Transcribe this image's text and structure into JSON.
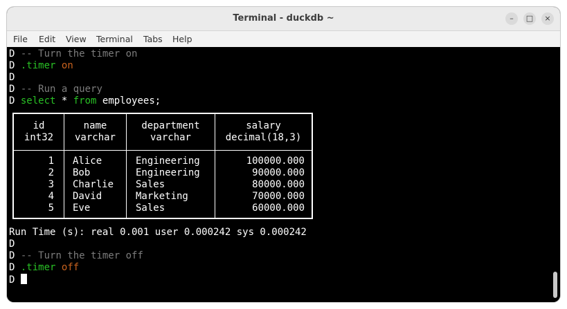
{
  "window": {
    "title": "Terminal - duckdb ~",
    "controls": {
      "minimize": "–",
      "maximize": "□",
      "close": "×"
    }
  },
  "menu": [
    "File",
    "Edit",
    "View",
    "Terminal",
    "Tabs",
    "Help"
  ],
  "terminal": {
    "prompt": "D",
    "lines": {
      "l1": "-- Turn the timer on",
      "l2_cmd": ".timer",
      "l2_arg": "on",
      "l4": "-- Run a query",
      "l5_kw1": "select",
      "l5_mid": " * ",
      "l5_kw2": "from",
      "l5_rest": " employees;",
      "runtime": "Run Time (s): real 0.001 user 0.000242 sys 0.000242",
      "l8": "-- Turn the timer off",
      "l9_cmd": ".timer",
      "l9_arg": "off"
    },
    "table": {
      "columns": [
        {
          "name": "id",
          "type": "int32"
        },
        {
          "name": "name",
          "type": "varchar"
        },
        {
          "name": "department",
          "type": "varchar"
        },
        {
          "name": "salary",
          "type": "decimal(18,3)"
        }
      ],
      "rows": [
        [
          "1",
          "Alice",
          "Engineering",
          "100000.000"
        ],
        [
          "2",
          "Bob",
          "Engineering",
          "90000.000"
        ],
        [
          "3",
          "Charlie",
          "Sales",
          "80000.000"
        ],
        [
          "4",
          "David",
          "Marketing",
          "70000.000"
        ],
        [
          "5",
          "Eve",
          "Sales",
          "60000.000"
        ]
      ]
    }
  },
  "colors": {
    "comment": "#7c7c7c",
    "keyword": "#29c025",
    "value": "#c8621e",
    "background": "#000000"
  }
}
